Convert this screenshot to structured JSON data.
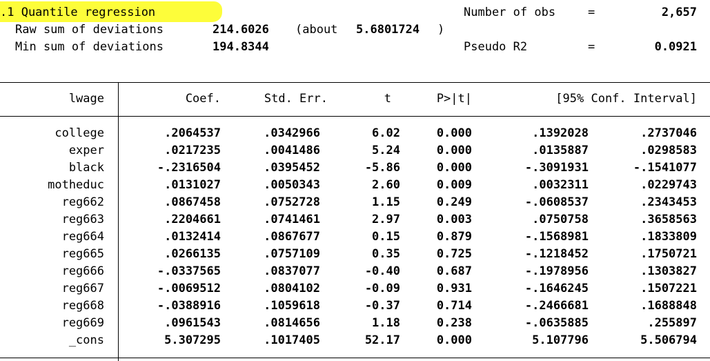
{
  "header": {
    "title": ".1 Quantile regression",
    "raw_label": "Raw sum of deviations",
    "raw_value": "214.6026",
    "about_open": "(about",
    "about_value": "5.6801724",
    "about_close": ")",
    "min_label": "Min sum of deviations",
    "min_value": "194.8344",
    "nobs_label": "Number of obs",
    "nobs_eq": "=",
    "nobs_value": "2,657",
    "r2_label": "Pseudo R2",
    "r2_eq": "=",
    "r2_value": "0.0921"
  },
  "table": {
    "depvar": "lwage",
    "headers": {
      "coef": "Coef.",
      "se": "Std. Err.",
      "t": "t",
      "p": "P>|t|",
      "ci": "[95% Conf. Interval]"
    },
    "rows": [
      {
        "var": "college",
        "coef": ".2064537",
        "se": ".0342966",
        "t": "6.02",
        "p": "0.000",
        "lo": ".1392028",
        "hi": ".2737046"
      },
      {
        "var": "exper",
        "coef": ".0217235",
        "se": ".0041486",
        "t": "5.24",
        "p": "0.000",
        "lo": ".0135887",
        "hi": ".0298583"
      },
      {
        "var": "black",
        "coef": "-.2316504",
        "se": ".0395452",
        "t": "-5.86",
        "p": "0.000",
        "lo": "-.3091931",
        "hi": "-.1541077"
      },
      {
        "var": "motheduc",
        "coef": ".0131027",
        "se": ".0050343",
        "t": "2.60",
        "p": "0.009",
        "lo": ".0032311",
        "hi": ".0229743"
      },
      {
        "var": "reg662",
        "coef": ".0867458",
        "se": ".0752728",
        "t": "1.15",
        "p": "0.249",
        "lo": "-.0608537",
        "hi": ".2343453"
      },
      {
        "var": "reg663",
        "coef": ".2204661",
        "se": ".0741461",
        "t": "2.97",
        "p": "0.003",
        "lo": ".0750758",
        "hi": ".3658563"
      },
      {
        "var": "reg664",
        "coef": ".0132414",
        "se": ".0867677",
        "t": "0.15",
        "p": "0.879",
        "lo": "-.1568981",
        "hi": ".1833809"
      },
      {
        "var": "reg665",
        "coef": ".0266135",
        "se": ".0757109",
        "t": "0.35",
        "p": "0.725",
        "lo": "-.1218452",
        "hi": ".1750721"
      },
      {
        "var": "reg666",
        "coef": "-.0337565",
        "se": ".0837077",
        "t": "-0.40",
        "p": "0.687",
        "lo": "-.1978956",
        "hi": ".1303827"
      },
      {
        "var": "reg667",
        "coef": "-.0069512",
        "se": ".0804102",
        "t": "-0.09",
        "p": "0.931",
        "lo": "-.1646245",
        "hi": ".1507221"
      },
      {
        "var": "reg668",
        "coef": "-.0388916",
        "se": ".1059618",
        "t": "-0.37",
        "p": "0.714",
        "lo": "-.2466681",
        "hi": ".1688848"
      },
      {
        "var": "reg669",
        "coef": ".0961543",
        "se": ".0814656",
        "t": "1.18",
        "p": "0.238",
        "lo": "-.0635885",
        "hi": ".255897"
      },
      {
        "var": "_cons",
        "coef": "5.307295",
        "se": ".1017405",
        "t": "52.17",
        "p": "0.000",
        "lo": "5.107796",
        "hi": "5.506794"
      }
    ]
  },
  "colors": {
    "highlight": "#fdfd3a",
    "text": "#000000",
    "background": "#ffffff"
  }
}
